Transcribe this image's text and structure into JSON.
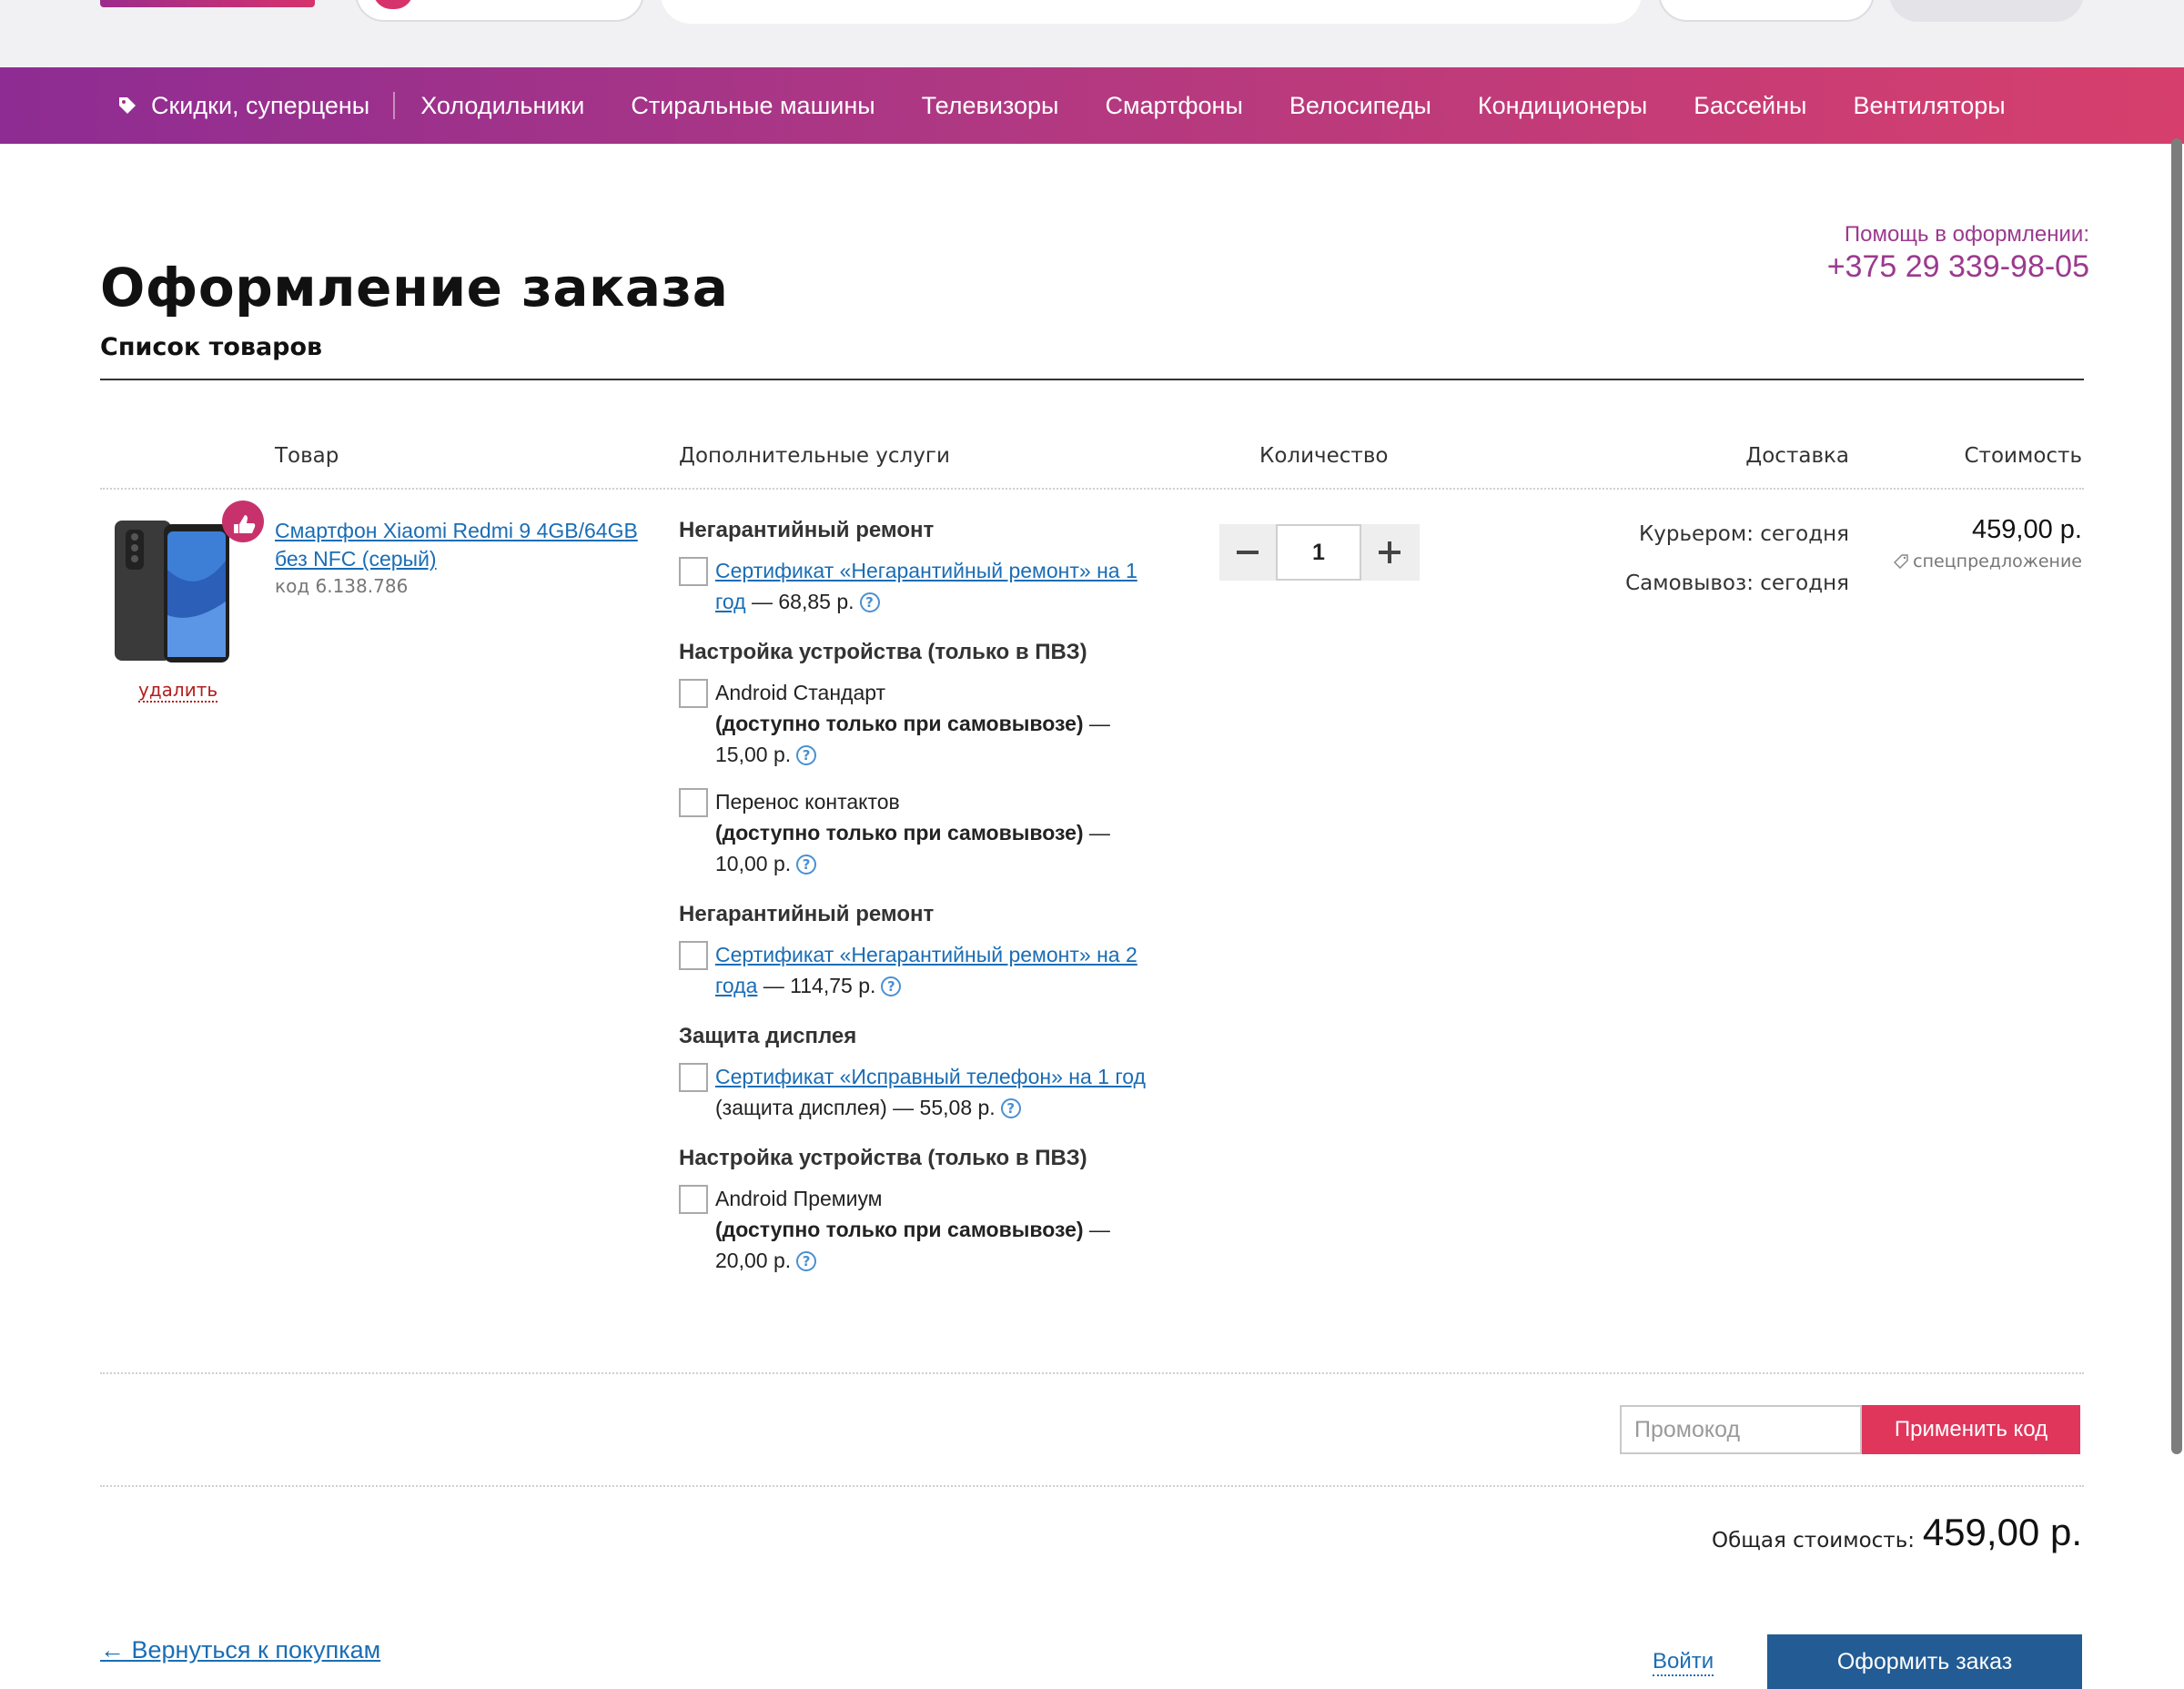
{
  "nav": {
    "items": [
      "Скидки, суперцены",
      "Холодильники",
      "Стиральные машины",
      "Телевизоры",
      "Смартфоны",
      "Велосипеды",
      "Кондиционеры",
      "Бассейны",
      "Вентиляторы"
    ]
  },
  "help": {
    "label": "Помощь в оформлении:",
    "phone": "+375 29 339-98-05"
  },
  "page": {
    "title": "Оформление заказа",
    "subtitle": "Список товаров"
  },
  "table": {
    "headers": {
      "item": "Товар",
      "services": "Дополнительные услуги",
      "quantity": "Количество",
      "delivery": "Доставка",
      "price": "Стоимость"
    }
  },
  "product": {
    "name": "Смартфон Xiaomi Redmi 9 4GB/64GB без NFC (серый)",
    "code": "код 6.138.786",
    "delete": "удалить",
    "quantity": "1",
    "delivery_courier": "Курьером: сегодня",
    "delivery_pickup": "Самовывоз: сегодня",
    "price": "459,00 р.",
    "special": "спецпредложение"
  },
  "services": {
    "g1": {
      "title": "Негарантийный ремонт",
      "link": "Сертификат «Негарантийный ремонт» на 1 год",
      "price": " — 68,85 р."
    },
    "g2": {
      "title": "Настройка устройства (только в ПВЗ)",
      "opt1_name": "Android Стандарт",
      "opt1_note": "(доступно только при самовывозе)",
      "opt1_price": " — 15,00 р.",
      "opt2_name": "Перенос контактов",
      "opt2_note": "(доступно только при самовывозе)",
      "opt2_price": " — 10,00 р."
    },
    "g3": {
      "title": "Негарантийный ремонт",
      "link": "Сертификат «Негарантийный ремонт» на 2 года",
      "price": " — 114,75 р."
    },
    "g4": {
      "title": "Защита дисплея",
      "link": "Сертификат «Исправный телефон» на 1 год",
      "extra": " (защита дисплея) — 55,08 р."
    },
    "g5": {
      "title": "Настройка устройства (только в ПВЗ)",
      "opt_name": "Android Премиум",
      "opt_note": "(доступно только при самовывозе)",
      "opt_price": " — 20,00 р."
    },
    "help_glyph": "?"
  },
  "promo": {
    "placeholder": "Промокод",
    "button": "Применить код"
  },
  "total": {
    "label": "Общая стоимость:",
    "value": "459,00 р."
  },
  "footer": {
    "back": "← Вернуться к покупкам",
    "login": "Войти",
    "checkout": "Оформить заказ"
  },
  "colors": {
    "nav_gradient_start": "#8e2c93",
    "nav_gradient_end": "#d63f6d",
    "brand_purple": "#9b3a8e",
    "link_blue": "#1a6db5",
    "promo_button": "#e1365c",
    "checkout_button": "#235c94",
    "delete_red": "#b21f1f"
  }
}
